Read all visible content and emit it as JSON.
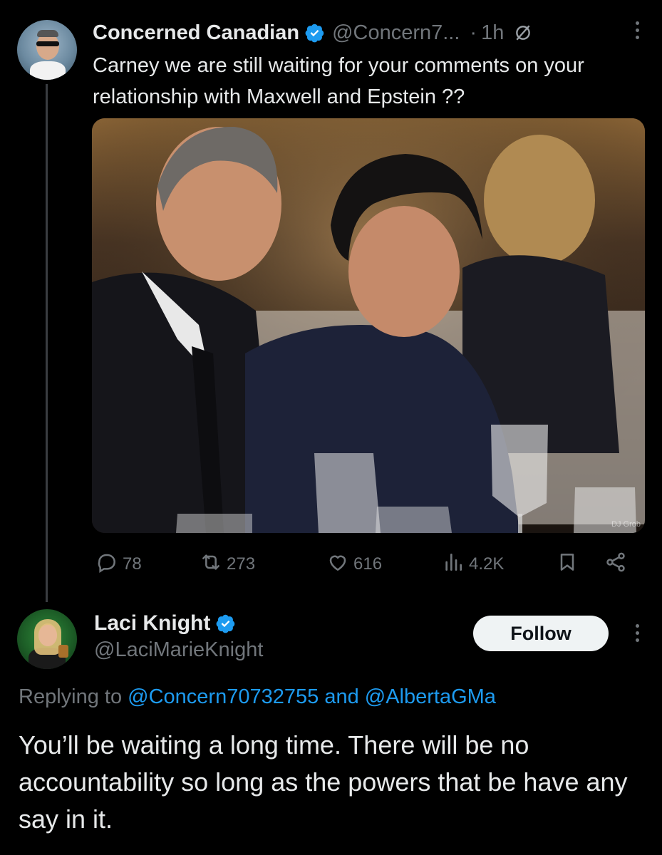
{
  "tweet": {
    "author_name": "Concerned Canadian",
    "author_handle": "@Concern7...",
    "separator": "·",
    "time": "1h",
    "text": "Carney we are still waiting for your comments on your relationship with Maxwell and Epstein ??",
    "media_watermark": "DJ Grob",
    "stats": {
      "replies": "78",
      "reposts": "273",
      "likes": "616",
      "views": "4.2K"
    }
  },
  "reply": {
    "author_name": "Laci Knight",
    "author_handle": "@LaciMarieKnight",
    "follow_label": "Follow",
    "replying_prefix": "Replying to",
    "replying_to_1": "@Concern70732755",
    "replying_and": "and",
    "replying_to_2": "@AlbertaGMa",
    "text": "You’ll be waiting a long time. There will be no accountability so long as the powers that be have any say in it."
  },
  "colors": {
    "background": "#000000",
    "text_primary": "#e7e9ea",
    "text_secondary": "#71767b",
    "link": "#1d9bf0",
    "verified": "#1d9bf0"
  },
  "icons": [
    "reply-icon",
    "repost-icon",
    "like-icon",
    "views-icon",
    "bookmark-icon",
    "share-icon",
    "verified-badge-icon",
    "more-icon",
    "grok-icon"
  ]
}
